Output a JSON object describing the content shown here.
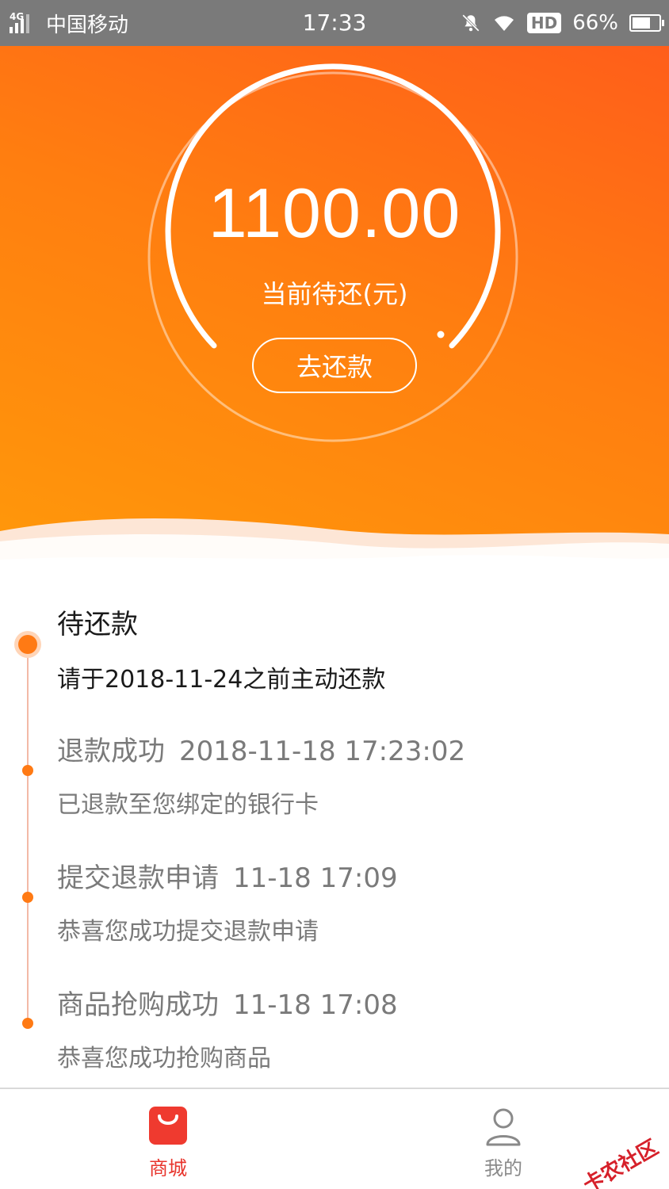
{
  "status_bar": {
    "network": "4G",
    "carrier": "中国移动",
    "time": "17:33",
    "hd": "HD",
    "battery": "66%"
  },
  "header": {
    "amount": "1100.00",
    "amount_label": "当前待还(元)",
    "repay_button": "去还款"
  },
  "timeline": [
    {
      "title": "待还款",
      "time": "",
      "desc": "请于2018-11-24之前主动还款"
    },
    {
      "title": "退款成功",
      "time": "2018-11-18 17:23:02",
      "desc": "已退款至您绑定的银行卡"
    },
    {
      "title": "提交退款申请",
      "time": "11-18 17:09",
      "desc": "恭喜您成功提交退款申请"
    },
    {
      "title": "商品抢购成功",
      "time": "11-18 17:08",
      "desc": "恭喜您成功抢购商品"
    }
  ],
  "bottom_nav": {
    "shop_label": "商城",
    "mine_label": "我的"
  },
  "watermark": "卡农社区",
  "colors": {
    "accent": "#ff7a14",
    "nav_active": "#e8342c"
  }
}
